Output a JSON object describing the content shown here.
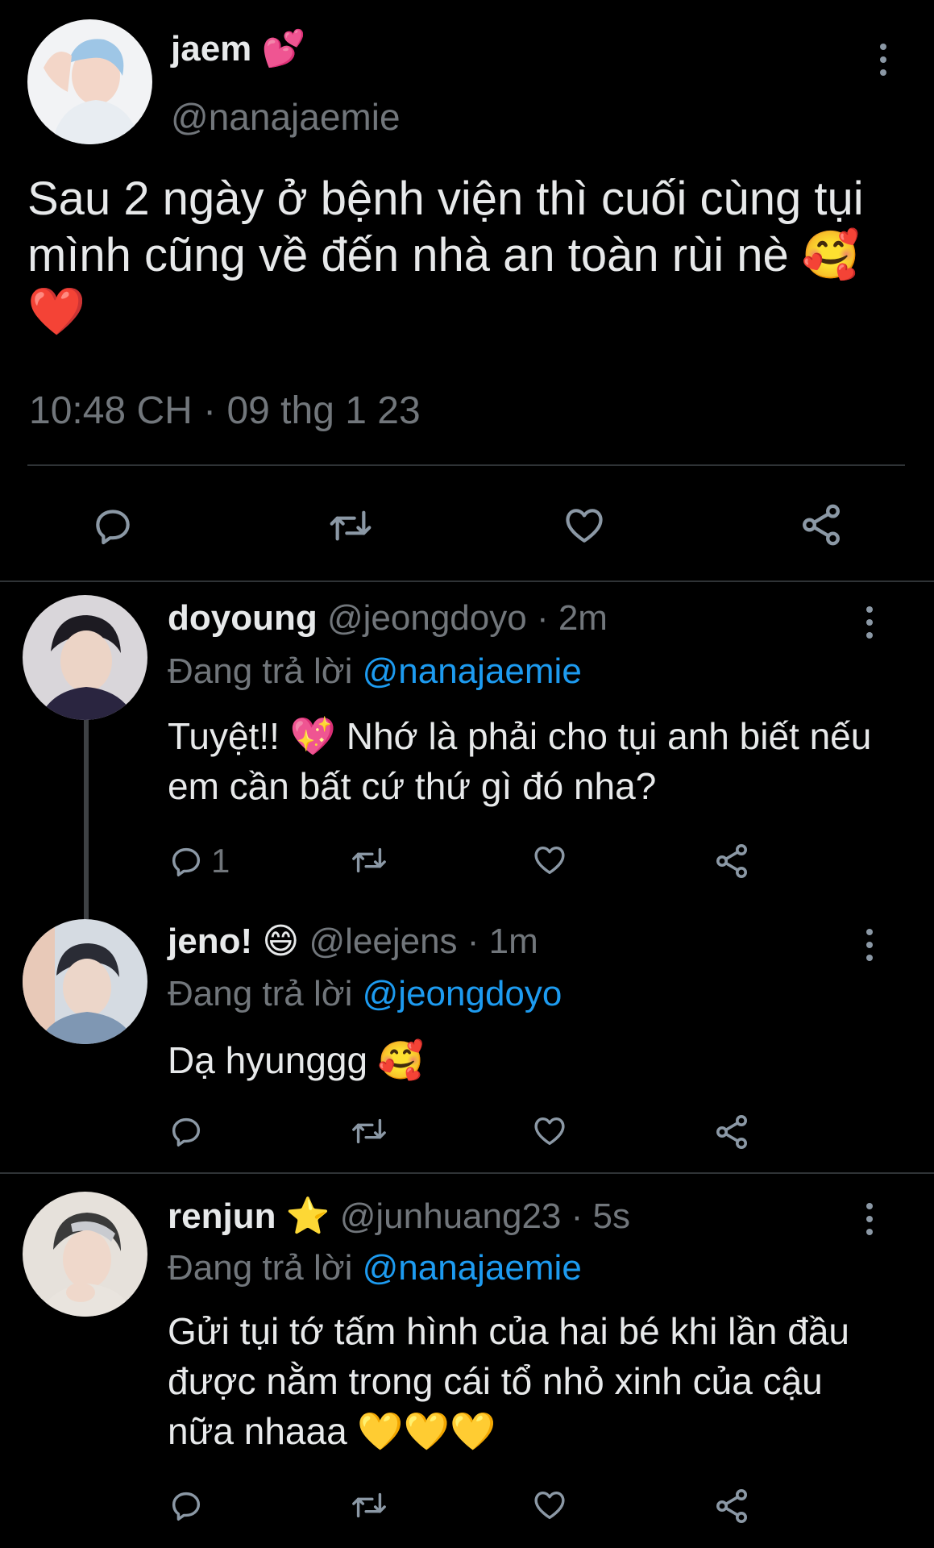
{
  "main_tweet": {
    "display_name": "jaem",
    "name_emoji": "💕",
    "handle": "@nanajaemie",
    "text": "Sau 2 ngày ở bệnh viện thì cuối cùng tụi mình cũng về đến nhà an toàn rùi nè",
    "text_emojis": "🥰❤️",
    "timestamp": "10:48 CH · 09 thg 1 23"
  },
  "replies": [
    {
      "display_name": "doyoung",
      "name_emoji": "",
      "handle": "@jeongdoyo",
      "time": "· 2m",
      "replying_prefix": "Đang trả lời",
      "replying_to": "@nanajaemie",
      "text": "Tuyệt!! 💖 Nhớ là phải cho tụi anh biết nếu em cần bất cứ thứ gì đó nha?",
      "reply_count": "1"
    },
    {
      "display_name": "jeno!",
      "name_emoji": "😄",
      "handle": "@leejens",
      "time": "· 1m",
      "replying_prefix": "Đang trả lời",
      "replying_to": "@jeongdoyo",
      "text": "Dạ hyunggg 🥰",
      "reply_count": ""
    },
    {
      "display_name": "renjun",
      "name_emoji": "⭐",
      "handle": "@junhuang23",
      "time": "· 5s",
      "replying_prefix": "Đang trả lời",
      "replying_to": "@nanajaemie",
      "text": "Gửi tụi tớ tấm hình của hai bé khi lần đầu được nằm trong cái tổ nhỏ xinh của cậu nữa nhaaa 💛💛💛",
      "reply_count": ""
    }
  ],
  "icons": {
    "reply": "reply-icon",
    "retweet": "retweet-icon",
    "like": "heart-icon",
    "share": "share-icon",
    "more": "more-vertical-icon"
  },
  "colors": {
    "background": "#000000",
    "text": "#e7e9ea",
    "muted": "#71767b",
    "link": "#1d9bf0",
    "divider": "#2f3336"
  }
}
